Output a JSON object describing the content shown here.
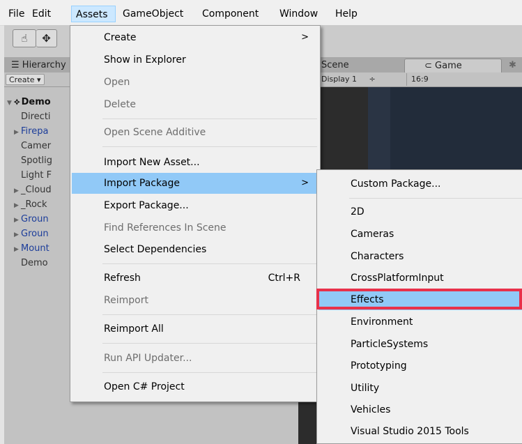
{
  "menubar": {
    "items": [
      "File",
      "Edit",
      "Assets",
      "GameObject",
      "Component",
      "Window",
      "Help"
    ],
    "active": "Assets"
  },
  "editor": {
    "toolbar": {
      "hand_icon": "hand-icon",
      "move_icon": "move-icon"
    },
    "tabs": {
      "hierarchy": "Hierarchy",
      "scene": "Scene",
      "game": "Game"
    },
    "hierarchy_create": "Create",
    "game_display": "Display 1",
    "game_aspect": "16:9",
    "hierarchy_items": [
      {
        "label": "Demo",
        "style": "bold",
        "arrow": "▼"
      },
      {
        "label": "Directi",
        "style": "grey",
        "arrow": ""
      },
      {
        "label": "Firepa",
        "style": "blue",
        "arrow": "▶"
      },
      {
        "label": "Camer",
        "style": "grey",
        "arrow": ""
      },
      {
        "label": "Spotlig",
        "style": "grey",
        "arrow": ""
      },
      {
        "label": "Light F",
        "style": "grey",
        "arrow": ""
      },
      {
        "label": "_Cloud",
        "style": "grey",
        "arrow": "▶"
      },
      {
        "label": "_Rock",
        "style": "grey",
        "arrow": "▶"
      },
      {
        "label": "Groun",
        "style": "blue",
        "arrow": "▶"
      },
      {
        "label": "Groun",
        "style": "blue",
        "arrow": "▶"
      },
      {
        "label": "Mount",
        "style": "blue",
        "arrow": "▶"
      },
      {
        "label": "Demo",
        "style": "grey",
        "arrow": ""
      }
    ]
  },
  "assets_menu": {
    "items": [
      {
        "label": "Create",
        "arrow": ">",
        "disabled": false
      },
      {
        "label": "Show in Explorer",
        "disabled": false
      },
      {
        "label": "Open",
        "disabled": true
      },
      {
        "label": "Delete",
        "disabled": true
      },
      {
        "label": "Open Scene Additive",
        "disabled": true
      },
      {
        "label": "Import New Asset...",
        "disabled": false
      },
      {
        "label": "Import Package",
        "arrow": ">",
        "disabled": false,
        "highlighted": true
      },
      {
        "label": "Export Package...",
        "disabled": false
      },
      {
        "label": "Find References In Scene",
        "disabled": true
      },
      {
        "label": "Select Dependencies",
        "disabled": false
      },
      {
        "label": "Refresh",
        "shortcut": "Ctrl+R",
        "disabled": false
      },
      {
        "label": "Reimport",
        "disabled": true
      },
      {
        "label": "Reimport All",
        "disabled": false
      },
      {
        "label": "Run API Updater...",
        "disabled": true
      },
      {
        "label": "Open C# Project",
        "disabled": false
      }
    ]
  },
  "import_package_submenu": {
    "items": [
      "Custom Package...",
      "2D",
      "Cameras",
      "Characters",
      "CrossPlatformInput",
      "Effects",
      "Environment",
      "ParticleSystems",
      "Prototyping",
      "Utility",
      "Vehicles",
      "Visual Studio 2015 Tools"
    ],
    "highlighted": "Effects"
  },
  "colors": {
    "highlight": "#91c9f7",
    "annotation_box": "#e8314a",
    "menu_bg": "#f0f0f0",
    "disabled_text": "#6d6d6d"
  }
}
